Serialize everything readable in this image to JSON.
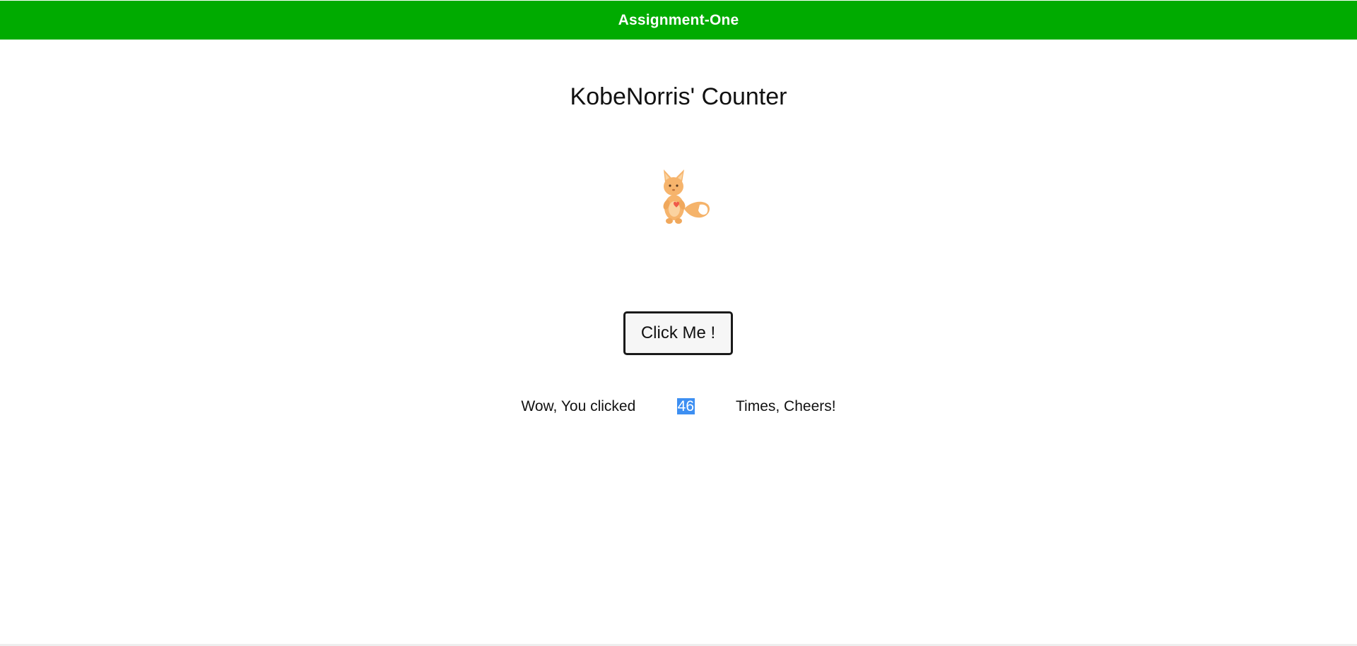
{
  "header": {
    "title": "Assignment-One",
    "background_color": "#00ab00"
  },
  "main": {
    "title": "KobeNorris' Counter",
    "mascot_icon": "fox-mascot-icon",
    "button_label": "Click Me !",
    "counter": {
      "prefix": "Wow, You clicked",
      "value": "46",
      "suffix": "Times, Cheers!",
      "highlight_color": "#3d8ff2"
    }
  }
}
